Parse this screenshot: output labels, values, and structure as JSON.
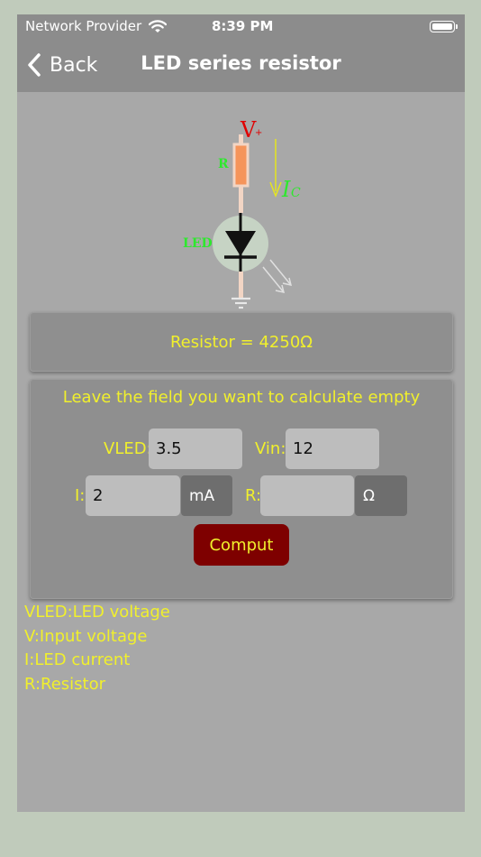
{
  "status_bar": {
    "carrier": "Network Provider",
    "time": "8:39 PM"
  },
  "nav": {
    "back_label": "Back",
    "title": "LED series resistor"
  },
  "circuit": {
    "v_label": "V",
    "v_sub": "+",
    "r_label": "R",
    "i_label": "I",
    "i_sub": "C",
    "led_label": "LED"
  },
  "result": {
    "text": "Resistor = 4250Ω"
  },
  "form": {
    "instruction": "Leave the field you want to calculate empty",
    "vled": {
      "label": "VLED:",
      "value": "3.5"
    },
    "vin": {
      "label": "Vin:",
      "value": "12"
    },
    "current": {
      "label": "I:",
      "value": "2",
      "unit": "mA"
    },
    "resistor": {
      "label": "R:",
      "value": "",
      "unit": "Ω"
    },
    "submit_label": "Comput"
  },
  "legend": [
    "VLED:LED voltage",
    "V:Input voltage",
    "I:LED current",
    "R:Resistor"
  ],
  "colors": {
    "background": "#a8a8a8",
    "nav_bar": "#8c8c8c",
    "accent_text": "#f1f02c",
    "button": "#7e0000",
    "wire": "#f2d5c4",
    "resistor": "#f5945a",
    "label_green": "#2ee82e",
    "label_red": "#e00000"
  }
}
